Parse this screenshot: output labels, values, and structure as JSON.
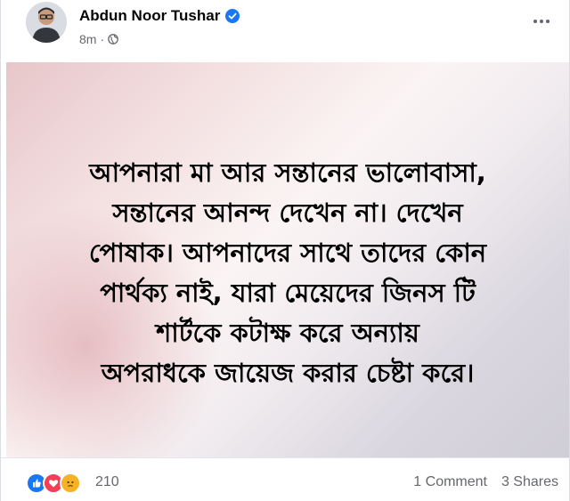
{
  "post": {
    "author": "Abdun Noor Tushar",
    "time": "8m",
    "separator": "·",
    "text_lines": [
      "আপনারা মা আর সন্তানের ভালোবাসা,",
      "সন্তানের আনন্দ দেখেন না। দেখেন",
      "পোষাক। আপনাদের সাথে তাদের কোন",
      "পার্থক্য নাই, যারা মেয়েদের জিনস টি",
      "শার্টকে কটাক্ষ করে অন্যায়",
      "অপরাধকে জায়েজ করার চেষ্টা করে।"
    ],
    "reactions": {
      "count": "210",
      "icons": [
        "like-icon",
        "love-icon",
        "sad-icon"
      ]
    },
    "comments": "1 Comment",
    "shares": "3 Shares"
  },
  "colors": {
    "like": "#1877f2",
    "love": "#f33e58",
    "sad": "#f7b125",
    "verified": "#1877f2",
    "secondary_text": "#65676b"
  }
}
